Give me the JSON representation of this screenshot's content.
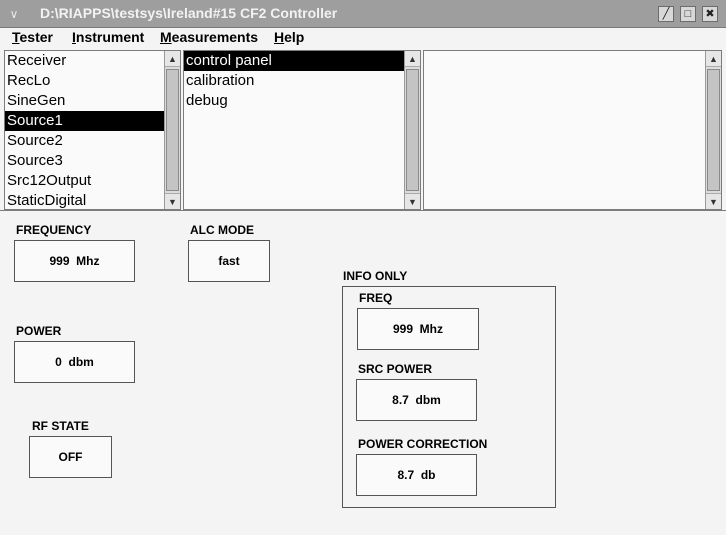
{
  "window": {
    "title": "D:\\RIAPPS\\testsys\\Ireland#15 CF2 Controller",
    "sysmenu_glyph": "∨",
    "min_glyph": "╱",
    "max_glyph": "□",
    "close_glyph": "✖"
  },
  "menubar": {
    "items": [
      {
        "mnemonic": "T",
        "rest": "ester"
      },
      {
        "mnemonic": "I",
        "rest": "nstrument"
      },
      {
        "mnemonic": "M",
        "rest": "easurements"
      },
      {
        "mnemonic": "H",
        "rest": "elp"
      }
    ]
  },
  "lists": {
    "instruments": [
      "Receiver",
      "RecLo",
      "SineGen",
      "Source1",
      "Source2",
      "Source3",
      "Src12Output",
      "StaticDigital"
    ],
    "instruments_selected": "Source1",
    "views": [
      "control panel",
      "calibration",
      "debug"
    ],
    "views_selected": "control panel",
    "details": []
  },
  "scroll": {
    "up_glyph": "▲",
    "down_glyph": "▼"
  },
  "panel": {
    "frequency": {
      "label": "FREQUENCY",
      "value": "999  Mhz"
    },
    "alc_mode": {
      "label": "ALC MODE",
      "value": "fast"
    },
    "power": {
      "label": "POWER",
      "value": "0  dbm"
    },
    "rf_state": {
      "label": "RF STATE",
      "value": "OFF"
    },
    "info_only": {
      "label": "INFO ONLY",
      "freq": {
        "label": "FREQ",
        "value": "999  Mhz"
      },
      "src_power": {
        "label": "SRC POWER",
        "value": "8.7  dbm"
      },
      "power_correction": {
        "label": "POWER CORRECTION",
        "value": "8.7  db"
      }
    }
  }
}
